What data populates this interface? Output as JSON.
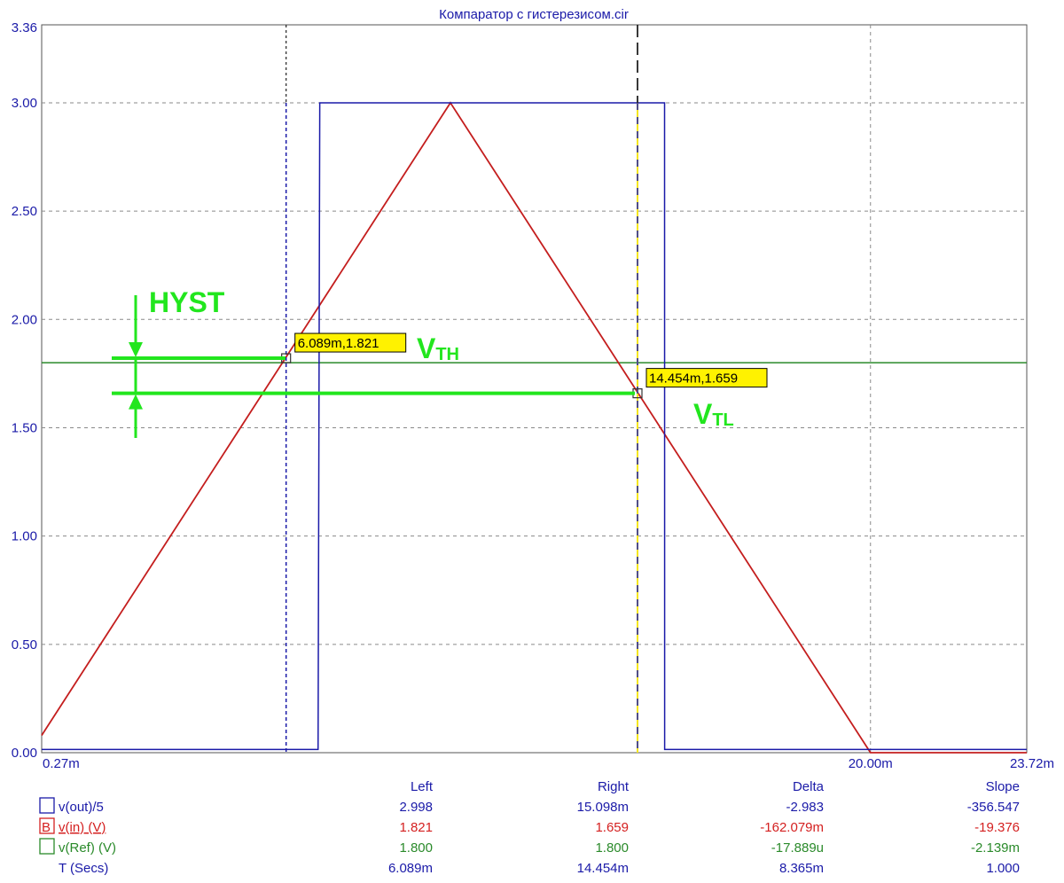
{
  "chart_data": {
    "type": "line",
    "title": "Компаратор с гистерезисом.cir",
    "xlabel": "",
    "ylabel": "",
    "xlim": [
      0.27,
      23.72
    ],
    "ylim": [
      0,
      3.36
    ],
    "x_unit": "ms",
    "y_ticks": [
      "3.36",
      "3.00",
      "2.50",
      "2.00",
      "1.50",
      "1.00",
      "0.50",
      "0.00"
    ],
    "y_tick_values": [
      3.36,
      3.0,
      2.5,
      2.0,
      1.5,
      1.0,
      0.5,
      0.0
    ],
    "x_ticks": [
      "0.27m",
      "20.00m",
      "23.72m"
    ],
    "x_tick_values": [
      0.27,
      20.0,
      23.72
    ],
    "grid": true,
    "series": [
      {
        "name": "v(out)/5",
        "color": "#1a1aa8",
        "x": [
          0.27,
          6.85,
          6.89,
          15.098,
          15.1,
          23.72
        ],
        "y": [
          0.015,
          0.015,
          3.0,
          3.0,
          0.015,
          0.015
        ]
      },
      {
        "name": "v(in) (V)",
        "color": "#c41e1e",
        "x": [
          0.27,
          10.0,
          20.0,
          23.72
        ],
        "y": [
          0.08,
          3.0,
          0.0,
          0.0
        ]
      },
      {
        "name": "v(Ref) (V)",
        "color": "#2a8a2a",
        "x": [
          0.27,
          23.72
        ],
        "y": [
          1.8,
          1.8
        ]
      }
    ],
    "cursors": [
      {
        "name": "Left",
        "x": 6.089,
        "color": "#222222",
        "style": "dotted"
      },
      {
        "name": "Right",
        "x": 14.454,
        "color": "#222222",
        "style": "dashed"
      }
    ],
    "cursor_labels": [
      {
        "text": "6.089m,1.821",
        "x": 6.089,
        "y": 1.821
      },
      {
        "text": "14.454m,1.659",
        "x": 14.454,
        "y": 1.659
      }
    ],
    "annotations": {
      "hyst_label": "HYST",
      "vth_main": "V",
      "vth_sub": "TH",
      "vtl_main": "V",
      "vtl_sub": "TL",
      "color": "#22e61e"
    }
  },
  "table": {
    "headers": [
      "Left",
      "Right",
      "Delta",
      "Slope"
    ],
    "rows": [
      {
        "label": "v(out)/5",
        "prefix": "",
        "color": "#1a1aa8",
        "box": true,
        "values": [
          "2.998",
          "15.098m",
          "-2.983",
          "-356.547"
        ]
      },
      {
        "label": "v(in) (V)",
        "prefix": "B",
        "color": "#d42020",
        "box": true,
        "values": [
          "1.821",
          "1.659",
          "-162.079m",
          "-19.376"
        ]
      },
      {
        "label": "v(Ref) (V)",
        "prefix": "",
        "color": "#2a8a2a",
        "box": true,
        "values": [
          "1.800",
          "1.800",
          "-17.889u",
          "-2.139m"
        ]
      },
      {
        "label": "T (Secs)",
        "prefix": "",
        "color": "#1a1aa8",
        "box": false,
        "values": [
          "6.089m",
          "14.454m",
          "8.365m",
          "1.000"
        ]
      }
    ]
  }
}
